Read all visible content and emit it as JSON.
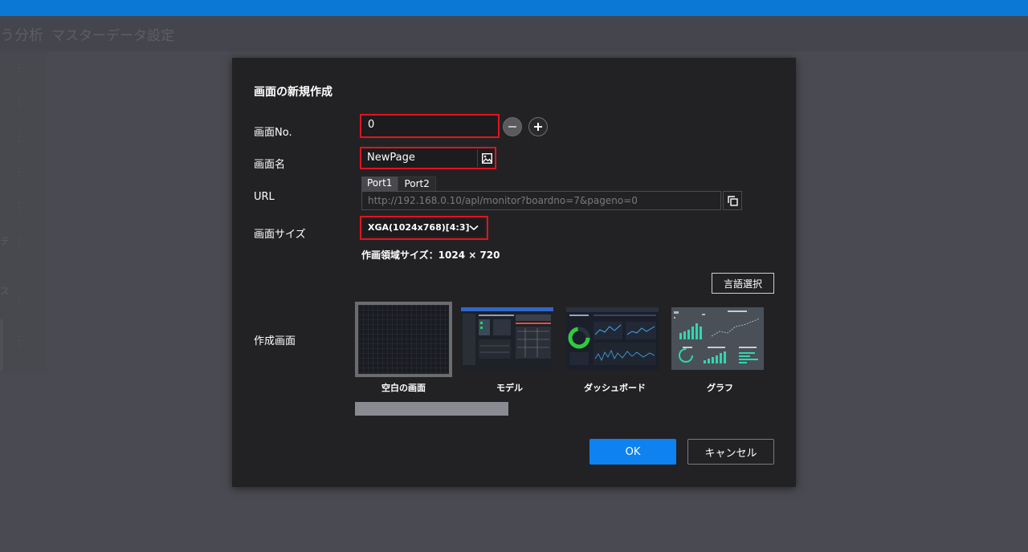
{
  "background": {
    "breadcrumb_part1": "う分析",
    "breadcrumb_part2": "マスターデータ設定",
    "sidebar_glyph_1": "テ",
    "sidebar_glyph_2": "ス"
  },
  "dialog": {
    "title": "画面の新規作成",
    "fields": {
      "page_no_label": "画面No.",
      "page_no_value": "0",
      "page_name_label": "画面名",
      "page_name_value": "NewPage",
      "url_label": "URL",
      "url_tabs": [
        "Port1",
        "Port2"
      ],
      "url_value": "http://192.168.0.10/apl/monitor?boardno=7&pageno=0",
      "size_label": "画面サイズ",
      "size_value": "XGA(1024x768)[4:3]",
      "area_size": "作画領域サイズ：1024 × 720"
    },
    "language_button": "言語選択",
    "create_label": "作成画面",
    "templates": [
      {
        "label": "空白の画面",
        "icon": "blank-grid-thumbnail",
        "selected": true
      },
      {
        "label": "モデル",
        "icon": "model-screen-thumbnail",
        "selected": false
      },
      {
        "label": "ダッシュボード",
        "icon": "dashboard-thumbnail",
        "selected": false
      },
      {
        "label": "グラフ",
        "icon": "graph-thumbnail",
        "selected": false
      }
    ],
    "ok_button": "OK",
    "cancel_button": "キャンセル"
  },
  "colors": {
    "accent_blue": "#0e82f0",
    "topbar": "#0a78d4",
    "highlight_red": "#e0141e",
    "dialog_bg": "#222224"
  }
}
